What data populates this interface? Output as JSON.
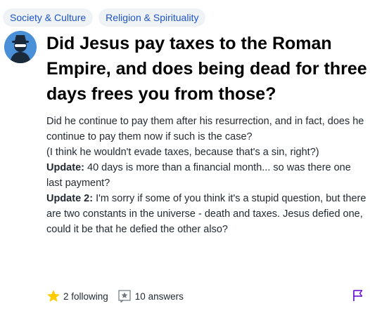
{
  "tags": [
    "Society & Culture",
    "Religion & Spirituality"
  ],
  "question": {
    "title": "Did Jesus pay taxes to the Roman Empire, and does being dead for three days frees you from those?",
    "details": "Did he continue to pay them after his resurrection, and in fact, does he continue to pay them now if such is the case?",
    "note": "(I think he wouldn't evade taxes, because that's a sin, right?)",
    "updates": [
      {
        "label": "Update:",
        "text": "40 days is more than a financial month... so was there one last payment?"
      },
      {
        "label": "Update 2:",
        "text": "I'm sorry if some of you think it's a stupid question, but there are two constants in the universe - death and taxes. Jesus defied one, could it be that he defied the other also?"
      }
    ]
  },
  "footer": {
    "following_label": "2 following",
    "answers_label": "10 answers"
  },
  "icons": {
    "avatar": "anonymous-user-icon",
    "star": "star-icon",
    "answer": "answer-icon",
    "flag": "flag-icon"
  },
  "colors": {
    "tag_text": "#1d54c6",
    "tag_bg": "#f0f3f5",
    "star": "#ffcc00",
    "flag": "#6001d2"
  }
}
